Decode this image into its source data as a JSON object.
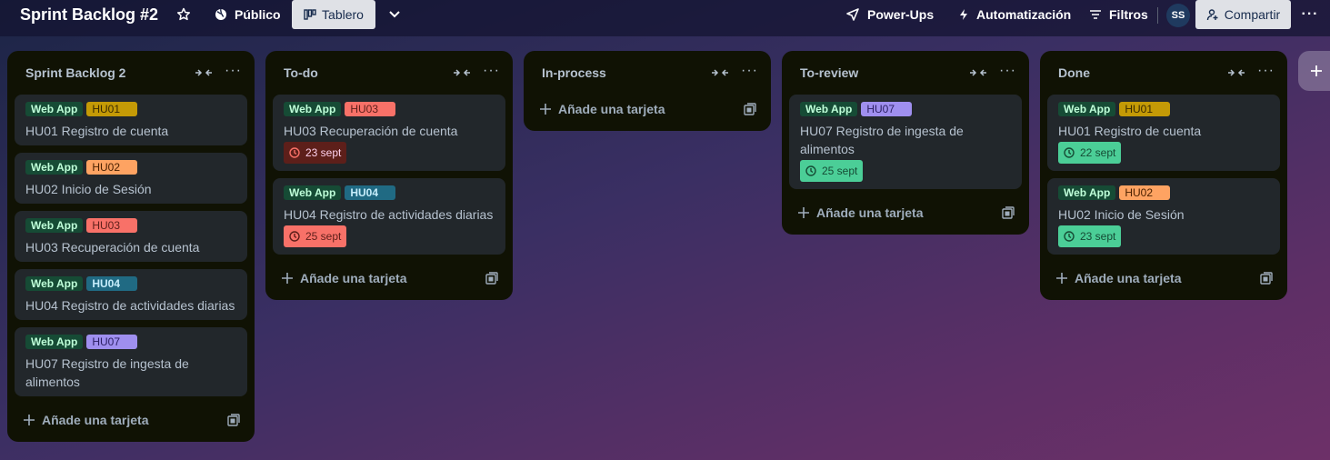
{
  "header": {
    "board_title": "Sprint Backlog #2",
    "visibility": "Público",
    "view": "Tablero",
    "power_ups": "Power-Ups",
    "automation": "Automatización",
    "filters": "Filtros",
    "avatar_initials": "SS",
    "share": "Compartir"
  },
  "lists": [
    {
      "title": "Sprint Backlog 2",
      "add_card": "Añade una tarjeta",
      "cards": [
        {
          "labels": [
            "Web App",
            "HU01"
          ],
          "title": "HU01 Registro de cuenta"
        },
        {
          "labels": [
            "Web App",
            "HU02"
          ],
          "title": "HU02 Inicio de Sesión"
        },
        {
          "labels": [
            "Web App",
            "HU03"
          ],
          "title": "HU03 Recuperación de cuenta"
        },
        {
          "labels": [
            "Web App",
            "HU04"
          ],
          "title": "HU04 Registro de actividades diarias"
        },
        {
          "labels": [
            "Web App",
            "HU07"
          ],
          "title": "HU07 Registro de ingesta de alimentos"
        }
      ]
    },
    {
      "title": "To-do",
      "add_card": "Añade una tarjeta",
      "cards": [
        {
          "labels": [
            "Web App",
            "HU03"
          ],
          "title": "HU03 Recuperación de cuenta",
          "due": "23 sept"
        },
        {
          "labels": [
            "Web App",
            "HU04"
          ],
          "title": "HU04 Registro de actividades diarias",
          "due": "25 sept"
        }
      ]
    },
    {
      "title": "In-process",
      "add_card": "Añade una tarjeta",
      "cards": []
    },
    {
      "title": "To-review",
      "add_card": "Añade una tarjeta",
      "cards": [
        {
          "labels": [
            "Web App",
            "HU07"
          ],
          "title": "HU07 Registro de ingesta de alimentos",
          "due": "25 sept"
        }
      ]
    },
    {
      "title": "Done",
      "add_card": "Añade una tarjeta",
      "cards": [
        {
          "labels": [
            "Web App",
            "HU01"
          ],
          "title": "HU01 Registro de cuenta",
          "due": "22 sept"
        },
        {
          "labels": [
            "Web App",
            "HU02"
          ],
          "title": "HU02 Inicio de Sesión",
          "due": "23 sept"
        }
      ]
    }
  ],
  "colors": {
    "label_web_app": "#164b35",
    "label_hu01": "#c49a06",
    "label_hu02": "#fea362",
    "label_hu03": "#f87168",
    "label_hu04": "#206a83",
    "label_hu07": "#9f8fef",
    "due_overdue": "#5d1f1a",
    "due_soon": "#f87168",
    "due_complete": "#4bce97"
  },
  "icons": {
    "visibility": "globe-icon",
    "star": "star-icon",
    "view": "board-icon",
    "view_menu": "chevron-down-icon",
    "power_ups": "rocket-icon",
    "automation": "lightning-icon",
    "filters": "filter-icon",
    "share": "add-person-icon",
    "more": "ellipsis-icon",
    "collapse": "collapse-icon",
    "template": "template-icon",
    "due": "clock-icon",
    "add": "plus-icon"
  }
}
